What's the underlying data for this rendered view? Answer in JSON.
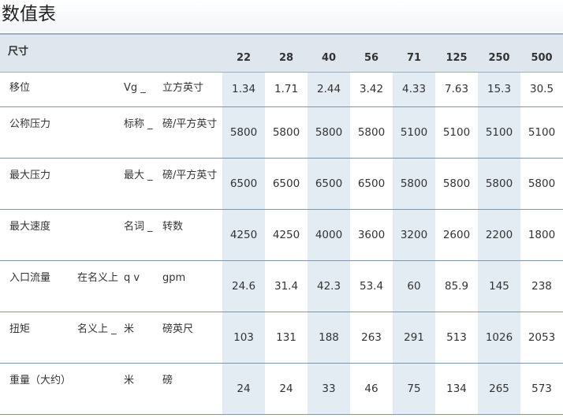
{
  "page": {
    "title": "数值表"
  },
  "table": {
    "size_header": "尺寸",
    "sizes": [
      "22",
      "28",
      "40",
      "56",
      "71",
      "125",
      "250",
      "500"
    ],
    "rows": [
      {
        "label": "移位",
        "sub": "",
        "sym": "Vg _",
        "unit": "立方英寸",
        "values": [
          "1.34",
          "1.71",
          "2.44",
          "3.42",
          "4.33",
          "7.63",
          "15.3",
          "30.5"
        ]
      },
      {
        "label": "公称压力",
        "sub": "",
        "sym": "标称 _",
        "unit": "磅/平方英寸",
        "values": [
          "5800",
          "5800",
          "5800",
          "5800",
          "5100",
          "5100",
          "5100",
          "5100"
        ]
      },
      {
        "label": "最大压力",
        "sub": "",
        "sym": "最大 _",
        "unit": "磅/平方英寸",
        "values": [
          "6500",
          "6500",
          "6500",
          "6500",
          "5800",
          "5800",
          "5800",
          "5800"
        ]
      },
      {
        "label": "最大速度",
        "sub": "",
        "sym": "名词 _",
        "unit": "转数",
        "values": [
          "4250",
          "4250",
          "4000",
          "3600",
          "3200",
          "2600",
          "2200",
          "1800"
        ]
      },
      {
        "label": "入口流量",
        "sub": "在名义上",
        "sym": "q v",
        "unit": "gpm",
        "values": [
          "24.6",
          "31.4",
          "42.3",
          "53.4",
          "60",
          "85.9",
          "145",
          "238"
        ]
      },
      {
        "label": "扭矩",
        "sub": "名义上 _",
        "sym": "米",
        "unit": "磅英尺",
        "values": [
          "103",
          "131",
          "188",
          "263",
          "291",
          "513",
          "1026",
          "2053"
        ]
      },
      {
        "label": "重量（大约）",
        "sub": "",
        "sym": "米",
        "unit": "磅",
        "values": [
          "24",
          "24",
          "33",
          "46",
          "75",
          "134",
          "265",
          "573"
        ]
      }
    ]
  }
}
